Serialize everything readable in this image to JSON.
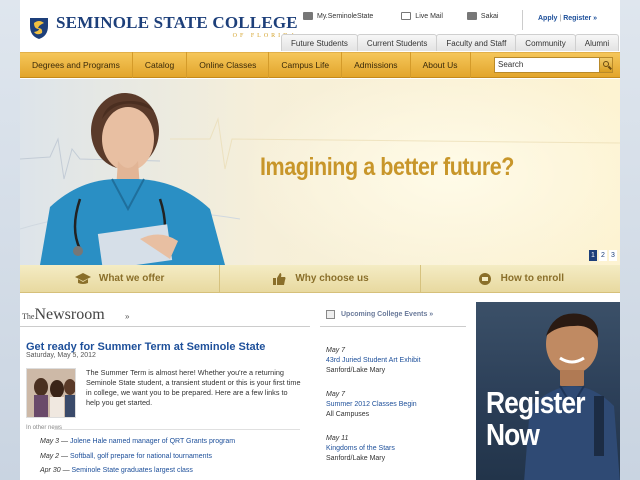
{
  "header": {
    "logo_name": "SEMINOLE STATE COLLEGE",
    "logo_sub": "OF FLORIDA",
    "quick_links": [
      {
        "label": "My.SeminoleState",
        "icon": "portal-icon"
      },
      {
        "label": "Live Mail",
        "icon": "mail-icon"
      },
      {
        "label": "Sakai",
        "icon": "computer-icon"
      }
    ],
    "apply_label": "Apply",
    "apply_sep": "|",
    "register_label": "Register »"
  },
  "audience_tabs": [
    "Future Students",
    "Current Students",
    "Faculty and Staff",
    "Community",
    "Alumni"
  ],
  "nav": {
    "items": [
      "Degrees and Programs",
      "Catalog",
      "Online Classes",
      "Campus Life",
      "Admissions",
      "About Us"
    ],
    "search_value": "Search"
  },
  "hero": {
    "headline": "Imagining a better future?",
    "pages": [
      "1",
      "2",
      "3"
    ],
    "active_page": "1"
  },
  "features": [
    {
      "label": "What we offer",
      "icon": "graduation-cap-icon"
    },
    {
      "label": "Why choose us",
      "icon": "thumbs-up-icon"
    },
    {
      "label": "How to enroll",
      "icon": "enroll-icon"
    }
  ],
  "newsroom": {
    "title_prefix": "The",
    "title": "Newsroom",
    "arrow": "»",
    "story_title": "Get ready for Summer Term at Seminole State",
    "story_date": "Saturday, May 5, 2012",
    "story_body": "The Summer Term is almost here! Whether you're a returning Seminole State student, a transient student or this is your first time in college, we want you to be prepared. Here are a few links to help you get started.",
    "other_label": "In other news",
    "other_news": [
      {
        "date": "May 3 — ",
        "text": "Jolene Hale named manager of QRT Grants program"
      },
      {
        "date": "May 2 — ",
        "text": "Softball, golf prepare for national tournaments"
      },
      {
        "date": "Apr 30 — ",
        "text": "Seminole State graduates largest class"
      }
    ]
  },
  "events": {
    "heading": "Upcoming College Events »",
    "items": [
      {
        "date": "May 7",
        "title": "43rd Juried Student Art Exhibit",
        "location": "Sanford/Lake Mary"
      },
      {
        "date": "May 7",
        "title": "Summer 2012 Classes Begin",
        "location": "All Campuses"
      },
      {
        "date": "May 11",
        "title": "Kingdoms of the Stars",
        "location": "Sanford/Lake Mary"
      }
    ]
  },
  "ad": {
    "line1": "Register",
    "line2": "Now"
  },
  "colors": {
    "brand_blue": "#1d3f7a",
    "brand_gold": "#d4a32c",
    "nav_gold": "#e2a52b",
    "link_blue": "#1d4f9a",
    "headline_gold": "#c8962a"
  }
}
